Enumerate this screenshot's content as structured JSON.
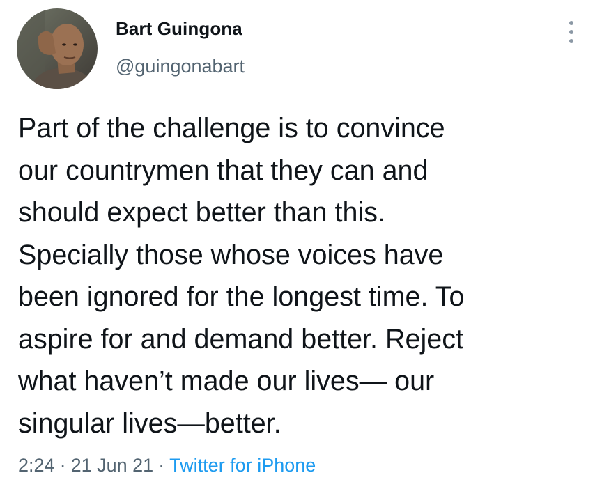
{
  "author": {
    "display_name": "Bart Guingona",
    "handle": "@guingonabart"
  },
  "tweet": {
    "lines": [
      "Part of the challenge is to convince",
      "our countrymen that they can and",
      "should expect better than this.",
      "Specially those whose voices have",
      "been ignored for the longest time. To",
      "aspire for and demand better. Reject",
      "what haven’t made our lives— our",
      "singular lives—better."
    ],
    "time": "2:24",
    "date": "21 Jun 21",
    "source": "Twitter for iPhone",
    "separator": "·"
  },
  "icons": {
    "more": "more-vertical-icon",
    "avatar": "avatar"
  },
  "colors": {
    "text_primary": "#0f1419",
    "text_secondary": "#536471",
    "link": "#1d9bf0",
    "background": "#ffffff"
  }
}
